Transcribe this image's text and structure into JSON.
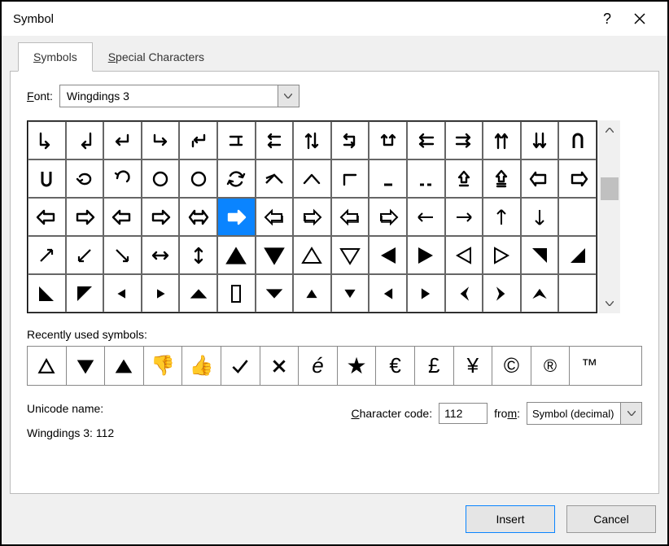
{
  "title": "Symbol",
  "tabs": {
    "symbols": "Symbols",
    "special": "Special Characters"
  },
  "font_label": "Font:",
  "font_value": "Wingdings 3",
  "recent_label": "Recently used symbols:",
  "unicode_name_label": "Unicode name:",
  "unicode_name_value": "Wingdings 3: 112",
  "char_code_label": "Character code:",
  "char_code_value": "112",
  "from_label": "from:",
  "from_value": "Symbol (decimal)",
  "insert_label": "Insert",
  "cancel_label": "Cancel",
  "selected_index": 35,
  "grid": [
    "arrow-down-right-corner",
    "arrow-down-left-corner",
    "arrow-return-left",
    "arrow-return-right",
    "arrow-return-double",
    "arrow-double-branch",
    "arrows-left-stacked",
    "arrows-up-down",
    "arrow-cycle-1",
    "arrow-cycle-2",
    "arrows-left-double",
    "arrows-right-double",
    "arrows-up-pair",
    "arrows-down-pair",
    "u-turn-down",
    "u-turn-up",
    "redo-small",
    "undo",
    "rotate-ccw",
    "rotate-cw",
    "refresh",
    "chevron-up-wide",
    "chevron-up",
    "angle-up-right",
    "underscore-short",
    "underscore-break",
    "up-outline-box",
    "up-outline-box-2",
    "left-outline-arrow",
    "right-outline-arrow",
    "left-hollow-arrow",
    "right-hollow-arrow-1",
    "left-hollow-arrow-2",
    "right-hollow-arrow-2",
    "left-right-hollow",
    "right-hollow-arrow-3",
    "left-shadow-arrow",
    "right-shadow-arrow",
    "left-shadow-arrow-2",
    "right-shadow-arrow-2",
    "thin-arrow-left",
    "thin-arrow-right",
    "thin-arrow-up",
    "thin-arrow-down",
    "blank-1",
    "arrow-ne",
    "arrow-sw",
    "arrow-se",
    "arrow-left-right",
    "arrow-up-down",
    "triangle-up-solid",
    "triangle-down-solid",
    "triangle-up-outline",
    "triangle-down-outline",
    "triangle-left-solid",
    "triangle-right-solid",
    "triangle-left-outline",
    "triangle-right-outline",
    "triangle-corner-ne",
    "triangle-corner-se",
    "triangle-corner-sw",
    "triangle-corner-nw",
    "pointer-left-small",
    "pointer-right-small",
    "pointer-up-flat",
    "rect-outline",
    "pointer-down-flat",
    "small-tri-up",
    "small-tri-down",
    "small-tri-left",
    "small-tri-right",
    "chevron-left-solid",
    "chevron-right-solid",
    "caret-up-solid",
    "blank-2"
  ],
  "recent": [
    "delta",
    "tri-down",
    "tri-up",
    "thumbs-down",
    "thumbs-up",
    "check",
    "cross",
    "e-acute",
    "star",
    "euro",
    "pound",
    "yen",
    "copyright",
    "registered",
    "trademark"
  ]
}
